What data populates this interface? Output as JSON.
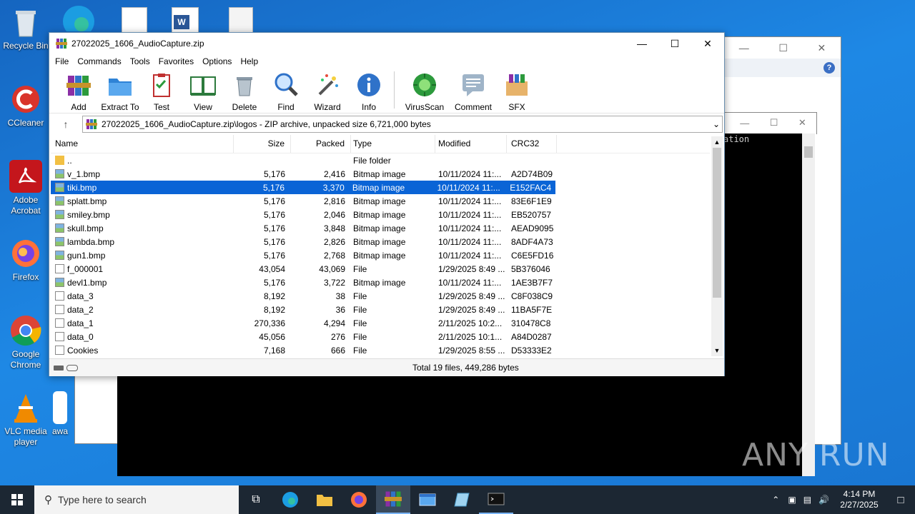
{
  "desktop": {
    "icons": [
      {
        "label": "Recycle Bin"
      },
      {
        "label": "CCleaner"
      },
      {
        "label": "Adobe Acrobat"
      },
      {
        "label": "Firefox"
      },
      {
        "label": "Google Chrome"
      },
      {
        "label": "VLC media player"
      },
      {
        "label": "awa"
      }
    ]
  },
  "console": {
    "text": "ation"
  },
  "winrar": {
    "title": "27022025_1606_AudioCapture.zip",
    "menu": [
      "File",
      "Commands",
      "Tools",
      "Favorites",
      "Options",
      "Help"
    ],
    "toolbar": [
      "Add",
      "Extract To",
      "Test",
      "View",
      "Delete",
      "Find",
      "Wizard",
      "Info",
      "VirusScan",
      "Comment",
      "SFX"
    ],
    "address": "27022025_1606_AudioCapture.zip\\logos - ZIP archive, unpacked size 6,721,000 bytes",
    "columns": [
      "Name",
      "Size",
      "Packed",
      "Type",
      "Modified",
      "CRC32"
    ],
    "rows": [
      {
        "name": "..",
        "size": "",
        "packed": "",
        "type": "File folder",
        "modified": "",
        "crc": "",
        "icon": "folder-icon"
      },
      {
        "name": "v_1.bmp",
        "size": "5,176",
        "packed": "2,416",
        "type": "Bitmap image",
        "modified": "10/11/2024 11:...",
        "crc": "A2D74B09",
        "icon": "bitmap-icon"
      },
      {
        "name": "tiki.bmp",
        "size": "5,176",
        "packed": "3,370",
        "type": "Bitmap image",
        "modified": "10/11/2024 11:...",
        "crc": "E152FAC4",
        "icon": "bitmap-icon",
        "selected": true
      },
      {
        "name": "splatt.bmp",
        "size": "5,176",
        "packed": "2,816",
        "type": "Bitmap image",
        "modified": "10/11/2024 11:...",
        "crc": "83E6F1E9",
        "icon": "bitmap-icon"
      },
      {
        "name": "smiley.bmp",
        "size": "5,176",
        "packed": "2,046",
        "type": "Bitmap image",
        "modified": "10/11/2024 11:...",
        "crc": "EB520757",
        "icon": "bitmap-icon"
      },
      {
        "name": "skull.bmp",
        "size": "5,176",
        "packed": "3,848",
        "type": "Bitmap image",
        "modified": "10/11/2024 11:...",
        "crc": "AEAD9095",
        "icon": "bitmap-icon"
      },
      {
        "name": "lambda.bmp",
        "size": "5,176",
        "packed": "2,826",
        "type": "Bitmap image",
        "modified": "10/11/2024 11:...",
        "crc": "8ADF4A73",
        "icon": "bitmap-icon"
      },
      {
        "name": "gun1.bmp",
        "size": "5,176",
        "packed": "2,768",
        "type": "Bitmap image",
        "modified": "10/11/2024 11:...",
        "crc": "C6E5FD16",
        "icon": "bitmap-icon"
      },
      {
        "name": "f_000001",
        "size": "43,054",
        "packed": "43,069",
        "type": "File",
        "modified": "1/29/2025 8:49 ...",
        "crc": "5B376046",
        "icon": "file-icon"
      },
      {
        "name": "devl1.bmp",
        "size": "5,176",
        "packed": "3,722",
        "type": "Bitmap image",
        "modified": "10/11/2024 11:...",
        "crc": "1AE3B7F7",
        "icon": "bitmap-icon"
      },
      {
        "name": "data_3",
        "size": "8,192",
        "packed": "38",
        "type": "File",
        "modified": "1/29/2025 8:49 ...",
        "crc": "C8F038C9",
        "icon": "file-icon"
      },
      {
        "name": "data_2",
        "size": "8,192",
        "packed": "36",
        "type": "File",
        "modified": "1/29/2025 8:49 ...",
        "crc": "11BA5F7E",
        "icon": "file-icon"
      },
      {
        "name": "data_1",
        "size": "270,336",
        "packed": "4,294",
        "type": "File",
        "modified": "2/11/2025 10:2...",
        "crc": "310478C8",
        "icon": "file-icon"
      },
      {
        "name": "data_0",
        "size": "45,056",
        "packed": "276",
        "type": "File",
        "modified": "2/11/2025 10:1...",
        "crc": "A84D0287",
        "icon": "file-icon"
      },
      {
        "name": "Cookies",
        "size": "7,168",
        "packed": "666",
        "type": "File",
        "modified": "1/29/2025 8:55 ...",
        "crc": "D53333E2",
        "icon": "file-icon"
      }
    ],
    "status": "Total 19 files, 449,286 bytes"
  },
  "taskbar": {
    "search_placeholder": "Type here to search",
    "time": "4:14 PM",
    "date": "2/27/2025"
  },
  "watermark": "ANY RUN"
}
